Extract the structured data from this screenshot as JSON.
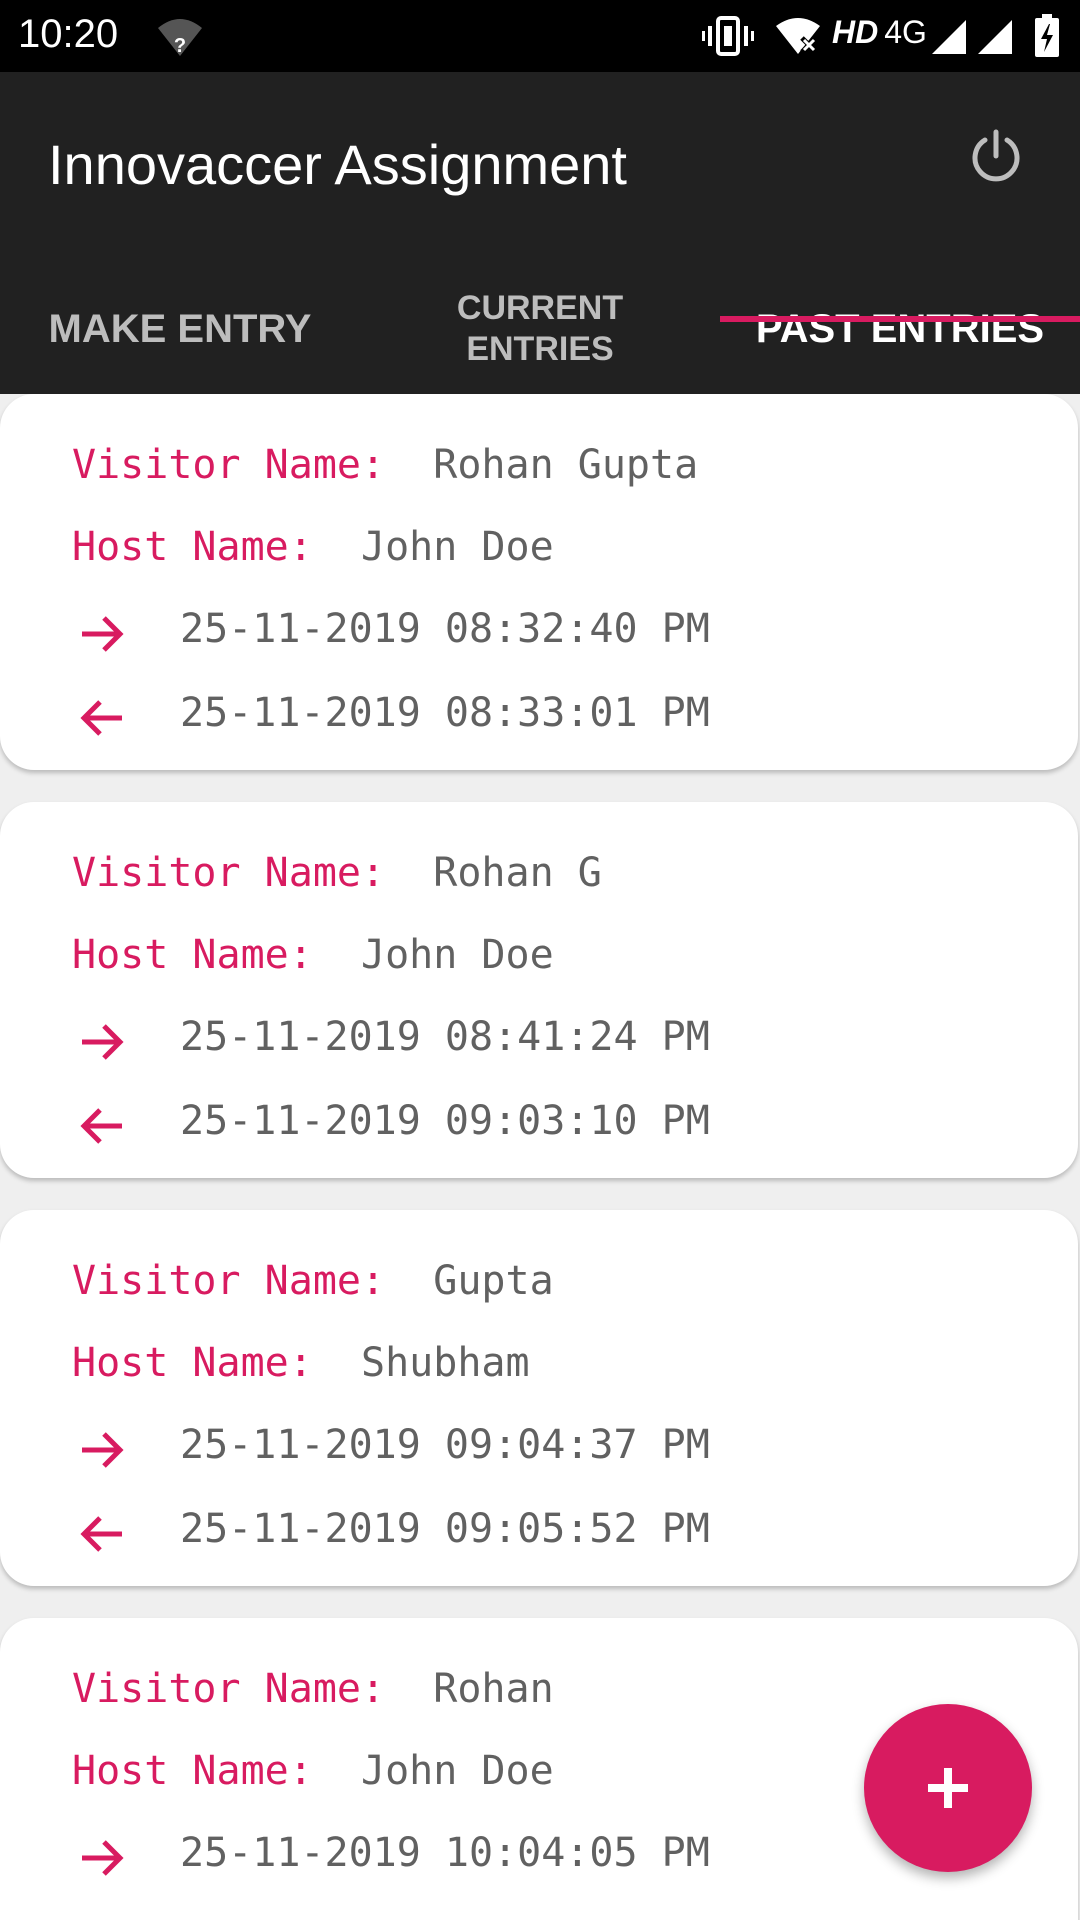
{
  "status_bar": {
    "time": "10:20",
    "network_label": "HD",
    "network_type": "4G",
    "icons": [
      "wifi-question-icon",
      "vibrate-icon",
      "wifi-off-icon",
      "signal-icon",
      "signal-icon",
      "battery-charging-icon"
    ]
  },
  "app_bar": {
    "title": "Innovaccer Assignment",
    "action_icon": "power-icon"
  },
  "tabs": [
    {
      "label": "MAKE ENTRY",
      "active": false
    },
    {
      "label": "CURRENT ENTRIES",
      "line1": "CURRENT",
      "line2": "ENTRIES",
      "active": false
    },
    {
      "label": "PAST ENTRIES",
      "active": true
    }
  ],
  "labels": {
    "visitor": "Visitor Name:",
    "host": "Host Name:"
  },
  "entries": [
    {
      "visitor": "Rohan Gupta",
      "host": "John Doe",
      "check_in": "25-11-2019 08:32:40 PM",
      "check_out": "25-11-2019 08:33:01 PM"
    },
    {
      "visitor": "Rohan G",
      "host": "John Doe",
      "check_in": "25-11-2019 08:41:24 PM",
      "check_out": "25-11-2019 09:03:10 PM"
    },
    {
      "visitor": "Gupta",
      "host": "Shubham",
      "check_in": "25-11-2019 09:04:37 PM",
      "check_out": "25-11-2019 09:05:52 PM"
    },
    {
      "visitor": "Rohan",
      "host": "John Doe",
      "check_in": "25-11-2019 10:04:05 PM",
      "check_out": ""
    }
  ],
  "fab": {
    "icon": "plus-icon"
  },
  "colors": {
    "accent": "#d81b60",
    "app_bar": "#212121",
    "status_bar": "#000000",
    "value_text": "#616161",
    "background": "#efefef"
  }
}
